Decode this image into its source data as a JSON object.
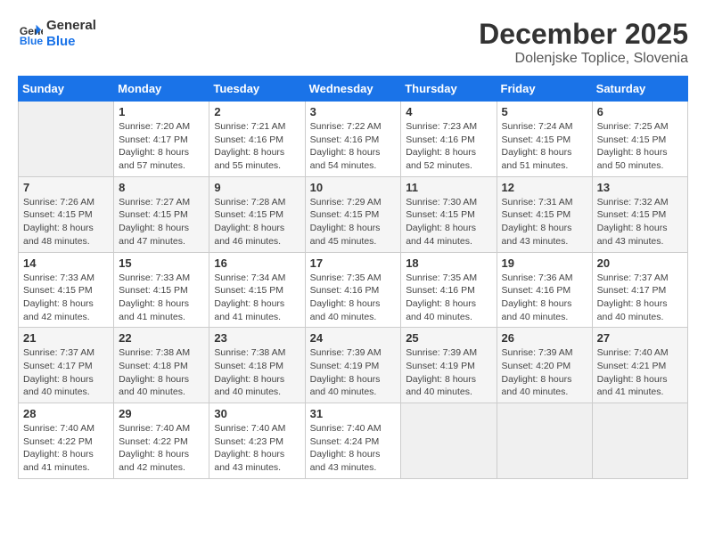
{
  "header": {
    "logo_line1": "General",
    "logo_line2": "Blue",
    "month_year": "December 2025",
    "location": "Dolenjske Toplice, Slovenia"
  },
  "days_of_week": [
    "Sunday",
    "Monday",
    "Tuesday",
    "Wednesday",
    "Thursday",
    "Friday",
    "Saturday"
  ],
  "weeks": [
    [
      {
        "day": "",
        "info": ""
      },
      {
        "day": "1",
        "info": "Sunrise: 7:20 AM\nSunset: 4:17 PM\nDaylight: 8 hours\nand 57 minutes."
      },
      {
        "day": "2",
        "info": "Sunrise: 7:21 AM\nSunset: 4:16 PM\nDaylight: 8 hours\nand 55 minutes."
      },
      {
        "day": "3",
        "info": "Sunrise: 7:22 AM\nSunset: 4:16 PM\nDaylight: 8 hours\nand 54 minutes."
      },
      {
        "day": "4",
        "info": "Sunrise: 7:23 AM\nSunset: 4:16 PM\nDaylight: 8 hours\nand 52 minutes."
      },
      {
        "day": "5",
        "info": "Sunrise: 7:24 AM\nSunset: 4:15 PM\nDaylight: 8 hours\nand 51 minutes."
      },
      {
        "day": "6",
        "info": "Sunrise: 7:25 AM\nSunset: 4:15 PM\nDaylight: 8 hours\nand 50 minutes."
      }
    ],
    [
      {
        "day": "7",
        "info": "Sunrise: 7:26 AM\nSunset: 4:15 PM\nDaylight: 8 hours\nand 48 minutes."
      },
      {
        "day": "8",
        "info": "Sunrise: 7:27 AM\nSunset: 4:15 PM\nDaylight: 8 hours\nand 47 minutes."
      },
      {
        "day": "9",
        "info": "Sunrise: 7:28 AM\nSunset: 4:15 PM\nDaylight: 8 hours\nand 46 minutes."
      },
      {
        "day": "10",
        "info": "Sunrise: 7:29 AM\nSunset: 4:15 PM\nDaylight: 8 hours\nand 45 minutes."
      },
      {
        "day": "11",
        "info": "Sunrise: 7:30 AM\nSunset: 4:15 PM\nDaylight: 8 hours\nand 44 minutes."
      },
      {
        "day": "12",
        "info": "Sunrise: 7:31 AM\nSunset: 4:15 PM\nDaylight: 8 hours\nand 43 minutes."
      },
      {
        "day": "13",
        "info": "Sunrise: 7:32 AM\nSunset: 4:15 PM\nDaylight: 8 hours\nand 43 minutes."
      }
    ],
    [
      {
        "day": "14",
        "info": "Sunrise: 7:33 AM\nSunset: 4:15 PM\nDaylight: 8 hours\nand 42 minutes."
      },
      {
        "day": "15",
        "info": "Sunrise: 7:33 AM\nSunset: 4:15 PM\nDaylight: 8 hours\nand 41 minutes."
      },
      {
        "day": "16",
        "info": "Sunrise: 7:34 AM\nSunset: 4:15 PM\nDaylight: 8 hours\nand 41 minutes."
      },
      {
        "day": "17",
        "info": "Sunrise: 7:35 AM\nSunset: 4:16 PM\nDaylight: 8 hours\nand 40 minutes."
      },
      {
        "day": "18",
        "info": "Sunrise: 7:35 AM\nSunset: 4:16 PM\nDaylight: 8 hours\nand 40 minutes."
      },
      {
        "day": "19",
        "info": "Sunrise: 7:36 AM\nSunset: 4:16 PM\nDaylight: 8 hours\nand 40 minutes."
      },
      {
        "day": "20",
        "info": "Sunrise: 7:37 AM\nSunset: 4:17 PM\nDaylight: 8 hours\nand 40 minutes."
      }
    ],
    [
      {
        "day": "21",
        "info": "Sunrise: 7:37 AM\nSunset: 4:17 PM\nDaylight: 8 hours\nand 40 minutes."
      },
      {
        "day": "22",
        "info": "Sunrise: 7:38 AM\nSunset: 4:18 PM\nDaylight: 8 hours\nand 40 minutes."
      },
      {
        "day": "23",
        "info": "Sunrise: 7:38 AM\nSunset: 4:18 PM\nDaylight: 8 hours\nand 40 minutes."
      },
      {
        "day": "24",
        "info": "Sunrise: 7:39 AM\nSunset: 4:19 PM\nDaylight: 8 hours\nand 40 minutes."
      },
      {
        "day": "25",
        "info": "Sunrise: 7:39 AM\nSunset: 4:19 PM\nDaylight: 8 hours\nand 40 minutes."
      },
      {
        "day": "26",
        "info": "Sunrise: 7:39 AM\nSunset: 4:20 PM\nDaylight: 8 hours\nand 40 minutes."
      },
      {
        "day": "27",
        "info": "Sunrise: 7:40 AM\nSunset: 4:21 PM\nDaylight: 8 hours\nand 41 minutes."
      }
    ],
    [
      {
        "day": "28",
        "info": "Sunrise: 7:40 AM\nSunset: 4:22 PM\nDaylight: 8 hours\nand 41 minutes."
      },
      {
        "day": "29",
        "info": "Sunrise: 7:40 AM\nSunset: 4:22 PM\nDaylight: 8 hours\nand 42 minutes."
      },
      {
        "day": "30",
        "info": "Sunrise: 7:40 AM\nSunset: 4:23 PM\nDaylight: 8 hours\nand 43 minutes."
      },
      {
        "day": "31",
        "info": "Sunrise: 7:40 AM\nSunset: 4:24 PM\nDaylight: 8 hours\nand 43 minutes."
      },
      {
        "day": "",
        "info": ""
      },
      {
        "day": "",
        "info": ""
      },
      {
        "day": "",
        "info": ""
      }
    ]
  ]
}
